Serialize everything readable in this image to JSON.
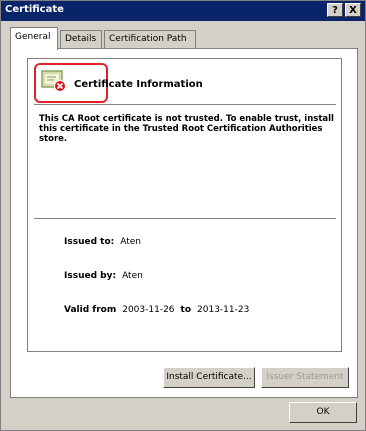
{
  "window": {
    "title": "Certificate",
    "help_label": "?",
    "close_label": "X"
  },
  "tabs": [
    {
      "label": "General"
    },
    {
      "label": "Details"
    },
    {
      "label": "Certification Path"
    }
  ],
  "general": {
    "heading": "Certificate Information",
    "message": "This CA Root certificate is not trusted. To enable trust, install this certificate in the Trusted Root Certification Authorities store.",
    "issued_to_label": "Issued to:",
    "issued_to_value": "Aten",
    "issued_by_label": "Issued by:",
    "issued_by_value": "Aten",
    "valid_from_label": "Valid from",
    "valid_from_value": "2003-11-26",
    "valid_to_label": "to",
    "valid_to_value": "2013-11-23"
  },
  "buttons": {
    "install_label": "Install Certificate...",
    "issuer_statement_label": "Issuer Statement",
    "ok_label": "OK"
  },
  "colors": {
    "highlight": "#e2212a",
    "titlebar": "#0a246a",
    "error_badge": "#d9141c"
  }
}
